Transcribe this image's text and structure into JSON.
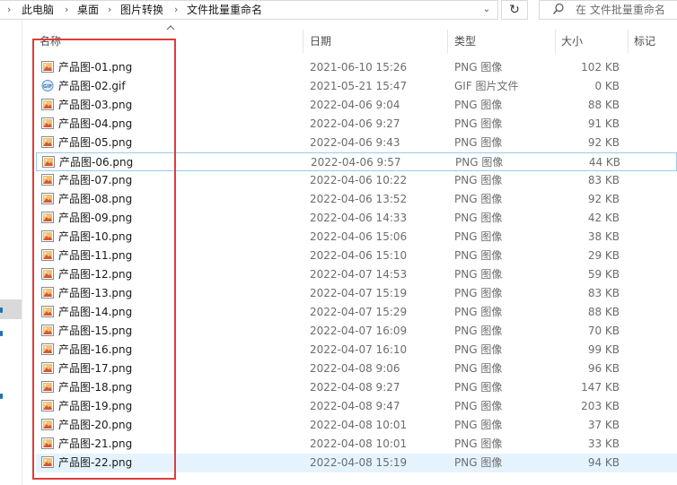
{
  "address": {
    "crumbs": [
      "此电脑",
      "桌面",
      "图片转换",
      "文件批量重命名"
    ],
    "search_placeholder": "在 文件批量重命名"
  },
  "columns": {
    "name": "名称",
    "date": "日期",
    "type": "类型",
    "size": "大小",
    "tags": "标记"
  },
  "colors": {
    "highlight_box": "#e03c3c",
    "selected_row": "#cce8ff",
    "hover_border": "#99c9ef"
  },
  "files": [
    {
      "name": "产品图-01.png",
      "date": "2021-06-10 15:26",
      "type": "PNG 图像",
      "size": "102 KB",
      "icon": "png-image-icon"
    },
    {
      "name": "产品图-02.gif",
      "date": "2021-05-21 15:47",
      "type": "GIF 图片文件",
      "size": "0 KB",
      "icon": "gif-file-icon"
    },
    {
      "name": "产品图-03.png",
      "date": "2022-04-06 9:04",
      "type": "PNG 图像",
      "size": "88 KB",
      "icon": "png-image-icon"
    },
    {
      "name": "产品图-04.png",
      "date": "2022-04-06 9:27",
      "type": "PNG 图像",
      "size": "91 KB",
      "icon": "png-image-icon"
    },
    {
      "name": "产品图-05.png",
      "date": "2022-04-06 9:43",
      "type": "PNG 图像",
      "size": "92 KB",
      "icon": "png-image-icon"
    },
    {
      "name": "产品图-06.png",
      "date": "2022-04-06 9:57",
      "type": "PNG 图像",
      "size": "44 KB",
      "icon": "png-image-icon"
    },
    {
      "name": "产品图-07.png",
      "date": "2022-04-06 10:22",
      "type": "PNG 图像",
      "size": "83 KB",
      "icon": "png-image-icon"
    },
    {
      "name": "产品图-08.png",
      "date": "2022-04-06 13:52",
      "type": "PNG 图像",
      "size": "92 KB",
      "icon": "png-image-icon"
    },
    {
      "name": "产品图-09.png",
      "date": "2022-04-06 14:33",
      "type": "PNG 图像",
      "size": "42 KB",
      "icon": "png-image-icon"
    },
    {
      "name": "产品图-10.png",
      "date": "2022-04-06 15:06",
      "type": "PNG 图像",
      "size": "38 KB",
      "icon": "png-image-icon"
    },
    {
      "name": "产品图-11.png",
      "date": "2022-04-06 15:10",
      "type": "PNG 图像",
      "size": "29 KB",
      "icon": "png-image-icon"
    },
    {
      "name": "产品图-12.png",
      "date": "2022-04-07 14:53",
      "type": "PNG 图像",
      "size": "59 KB",
      "icon": "png-image-icon"
    },
    {
      "name": "产品图-13.png",
      "date": "2022-04-07 15:19",
      "type": "PNG 图像",
      "size": "83 KB",
      "icon": "png-image-icon"
    },
    {
      "name": "产品图-14.png",
      "date": "2022-04-07 15:29",
      "type": "PNG 图像",
      "size": "88 KB",
      "icon": "png-image-icon"
    },
    {
      "name": "产品图-15.png",
      "date": "2022-04-07 16:09",
      "type": "PNG 图像",
      "size": "70 KB",
      "icon": "png-image-icon"
    },
    {
      "name": "产品图-16.png",
      "date": "2022-04-07 16:10",
      "type": "PNG 图像",
      "size": "99 KB",
      "icon": "png-image-icon"
    },
    {
      "name": "产品图-17.png",
      "date": "2022-04-08 9:06",
      "type": "PNG 图像",
      "size": "96 KB",
      "icon": "png-image-icon"
    },
    {
      "name": "产品图-18.png",
      "date": "2022-04-08 9:27",
      "type": "PNG 图像",
      "size": "147 KB",
      "icon": "png-image-icon"
    },
    {
      "name": "产品图-19.png",
      "date": "2022-04-08 9:47",
      "type": "PNG 图像",
      "size": "203 KB",
      "icon": "png-image-icon"
    },
    {
      "name": "产品图-20.png",
      "date": "2022-04-08 10:01",
      "type": "PNG 图像",
      "size": "37 KB",
      "icon": "png-image-icon"
    },
    {
      "name": "产品图-21.png",
      "date": "2022-04-08 10:01",
      "type": "PNG 图像",
      "size": "33 KB",
      "icon": "png-image-icon"
    },
    {
      "name": "产品图-22.png",
      "date": "2022-04-08 15:19",
      "type": "PNG 图像",
      "size": "94 KB",
      "icon": "png-image-icon"
    }
  ]
}
